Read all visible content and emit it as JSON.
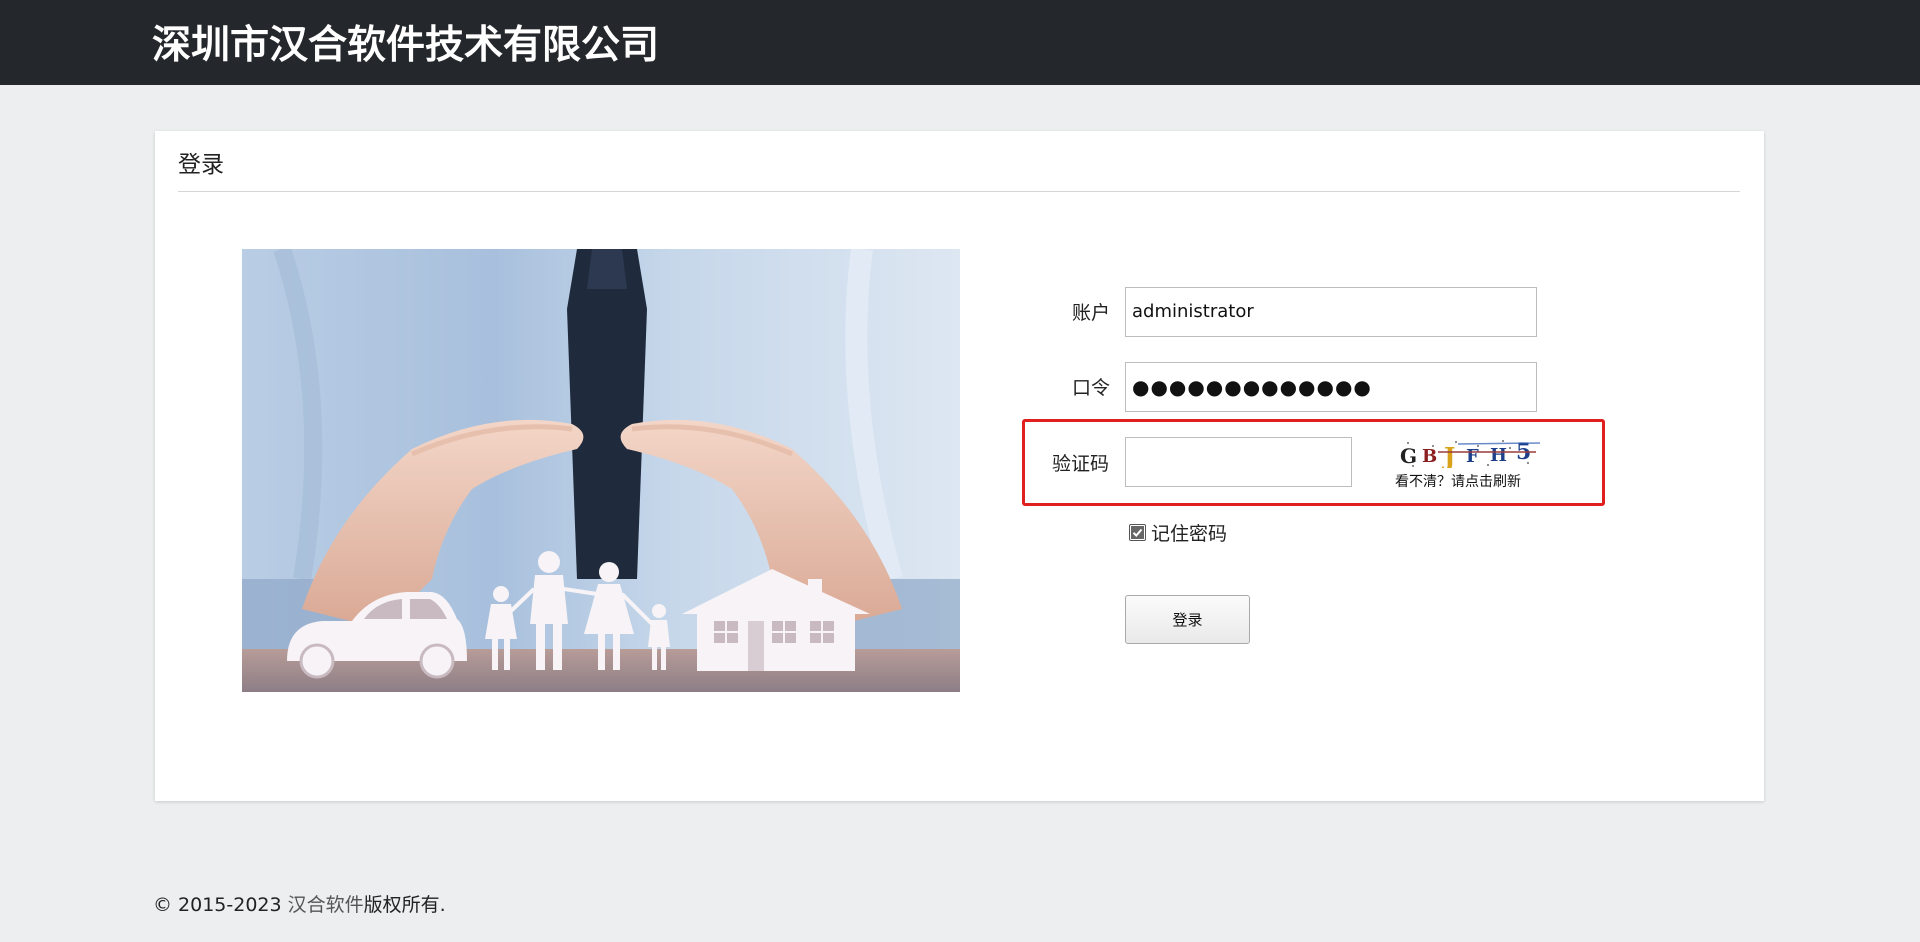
{
  "header": {
    "company_name": "深圳市汉合软件技术有限公司",
    "background_color": "#24272b"
  },
  "login_panel": {
    "title": "登录",
    "account": {
      "label": "账户",
      "value": "administrator"
    },
    "password": {
      "label": "口令",
      "masked_value": "●●●●●●●●●●●●●"
    },
    "captcha": {
      "label": "验证码",
      "value": "",
      "image_text": "GBJFH5",
      "refresh_text": "看不清？请点击刷新",
      "highlight_color": "#e01f1f"
    },
    "remember": {
      "label": "记住密码",
      "checked": true
    },
    "submit_label": "登录"
  },
  "footer": {
    "copyright_prefix": "© 2015-2023 ",
    "brand_link": "汉合软件",
    "copyright_suffix": "版权所有."
  },
  "icons": [
    "family-house-car-illustration",
    "checkbox-check-icon",
    "captcha-image"
  ]
}
